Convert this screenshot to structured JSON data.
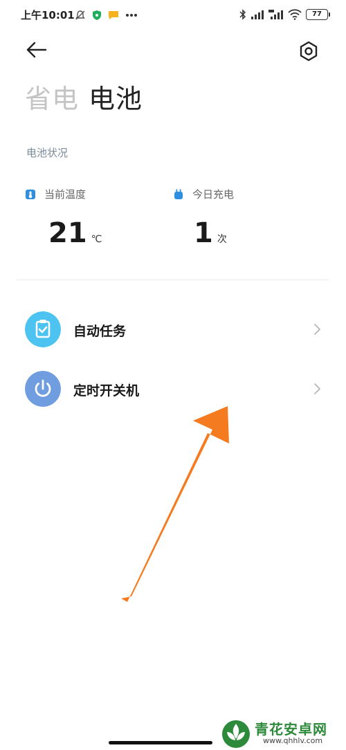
{
  "status_bar": {
    "time": "上午10:01",
    "left_icons": [
      "bell-off-icon",
      "shield-icon",
      "message-icon",
      "more-dots-icon"
    ],
    "right_icons": [
      "bluetooth-icon",
      "signal-icon",
      "hd-signal-icon",
      "wifi-icon"
    ],
    "battery_level": "77"
  },
  "header": {
    "back_icon": "back-arrow-icon",
    "settings_icon": "settings-hexagon-icon"
  },
  "tabs": [
    {
      "label": "省电",
      "active": false
    },
    {
      "label": "电池",
      "active": true
    }
  ],
  "battery_status": {
    "section_label": "电池状况",
    "temperature": {
      "label": "当前温度",
      "value": "21",
      "unit": "℃",
      "icon": "thermometer-icon"
    },
    "charges_today": {
      "label": "今日充电",
      "value": "1",
      "unit": "次",
      "icon": "plug-icon"
    }
  },
  "menu": [
    {
      "label": "自动任务",
      "icon": "clipboard-check-icon",
      "icon_color": "#4cc3f0"
    },
    {
      "label": "定时开关机",
      "icon": "power-icon",
      "icon_color": "#6f9de0"
    }
  ],
  "colors": {
    "accent_blue": "#2e8fe0",
    "annotation_arrow": "#f47b20"
  },
  "watermark": {
    "title": "青花安卓网",
    "url": "www.qhhlv.com"
  }
}
